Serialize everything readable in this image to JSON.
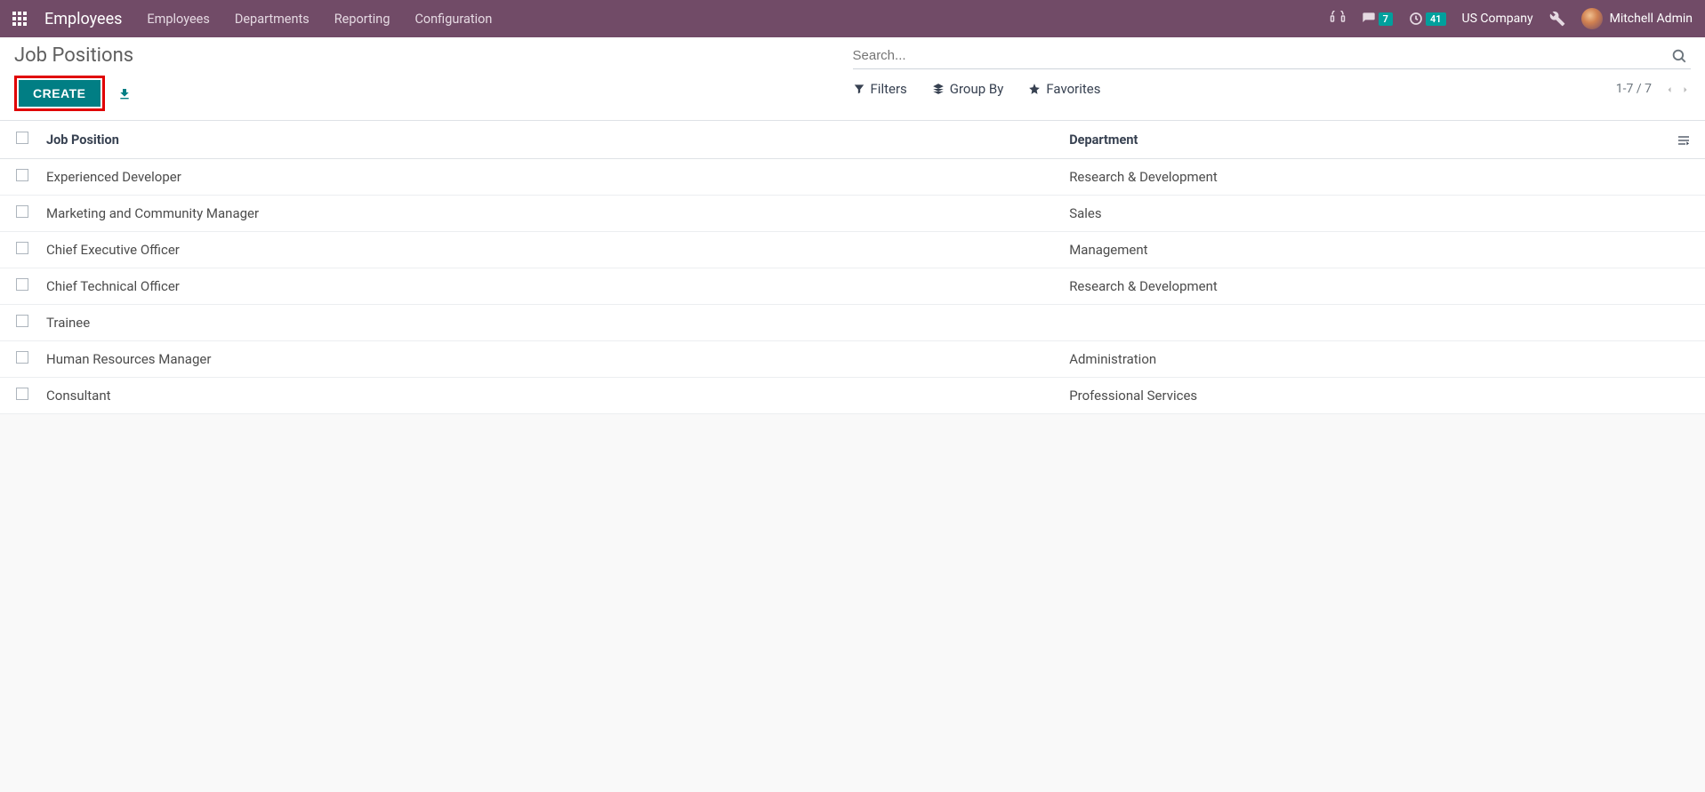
{
  "navbar": {
    "app_title": "Employees",
    "menu": [
      "Employees",
      "Departments",
      "Reporting",
      "Configuration"
    ],
    "messages_badge": "7",
    "activities_badge": "41",
    "company": "US Company",
    "user": "Mitchell Admin"
  },
  "control_panel": {
    "breadcrumb": "Job Positions",
    "create_label": "CREATE",
    "search_placeholder": "Search...",
    "filters_label": "Filters",
    "groupby_label": "Group By",
    "favorites_label": "Favorites",
    "pager": "1-7 / 7"
  },
  "table": {
    "columns": {
      "position": "Job Position",
      "department": "Department"
    },
    "rows": [
      {
        "position": "Experienced Developer",
        "department": "Research & Development"
      },
      {
        "position": "Marketing and Community Manager",
        "department": "Sales"
      },
      {
        "position": "Chief Executive Officer",
        "department": "Management"
      },
      {
        "position": "Chief Technical Officer",
        "department": "Research & Development"
      },
      {
        "position": "Trainee",
        "department": ""
      },
      {
        "position": "Human Resources Manager",
        "department": "Administration"
      },
      {
        "position": "Consultant",
        "department": "Professional Services"
      }
    ]
  }
}
